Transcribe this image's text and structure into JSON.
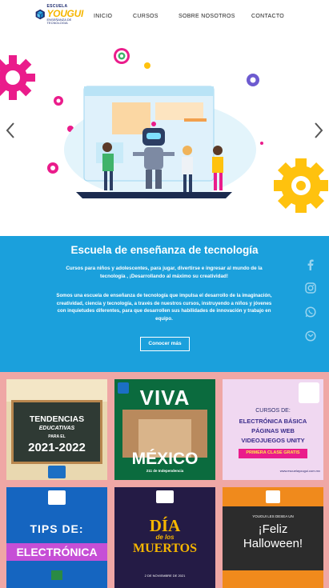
{
  "brand": {
    "top": "ESCUELA",
    "name": "YOUGUI",
    "sub": "ENSEÑANZA DE TECNOLOGIA"
  },
  "nav": {
    "items": [
      "INICIO",
      "CURSOS",
      "SOBRE NOSOTROS",
      "CONTACTO"
    ]
  },
  "hero": {
    "prev_icon": "chevron-left-icon",
    "next_icon": "chevron-right-icon"
  },
  "intro": {
    "title": "Escuela de enseñanza de tecnología",
    "paragraph1": "Cursos para niños y adolescentes, para jugar, divertirse e ingresar al mundo de la tecnología , ¡Desarrollando al máximo su creatividad!",
    "paragraph2": "Somos una escuela de enseñanza de tecnología que impulsa el desarrollo de la imaginación, creatividad, ciencia y tecnología, a través de nuestros cursos, instruyendo a niños y jóvenes con inquietudes diferentes, para que desarrollen sus habilidades de innovación y trabajo en equipo.",
    "button": "Conocer más"
  },
  "social": [
    "facebook-icon",
    "instagram-icon",
    "whatsapp-icon",
    "email-icon"
  ],
  "posts": [
    {
      "line1": "TENDENCIAS",
      "line2": "EDUCATIVAS",
      "line3": "PARA EL",
      "line4": "2021-2022"
    },
    {
      "line1": "VIVA",
      "line2": "MÉXICO",
      "line3": "211 de Independencia",
      "line4": ""
    },
    {
      "line1": "CURSOS DE:",
      "line2": "ELECTRÓNICA BÁSICA",
      "line3": "PÁGINAS WEB",
      "line4": "VIDEOJUEGOS UNITY",
      "line5": "PRIMERA CLASE GRATIS",
      "line6": "www.escuelayougui.com.mx"
    },
    {
      "line1": "TIPS DE:",
      "line2": "ELECTRÓNICA",
      "line3": "",
      "line4": ""
    },
    {
      "line1": "DÍA",
      "line2": "de los",
      "line3": "MUERTOS",
      "line4": "2 DE NOVIEMBRE DE 2021"
    },
    {
      "line1": "YOUGUI LES DESEA UN",
      "line2": "¡Feliz",
      "line3": "Halloween!",
      "line4": ""
    }
  ],
  "colors": {
    "band": "#1ba0dc",
    "grid": "#efa7a5",
    "accent": "#f6b600",
    "magenta": "#ea1c8b"
  }
}
